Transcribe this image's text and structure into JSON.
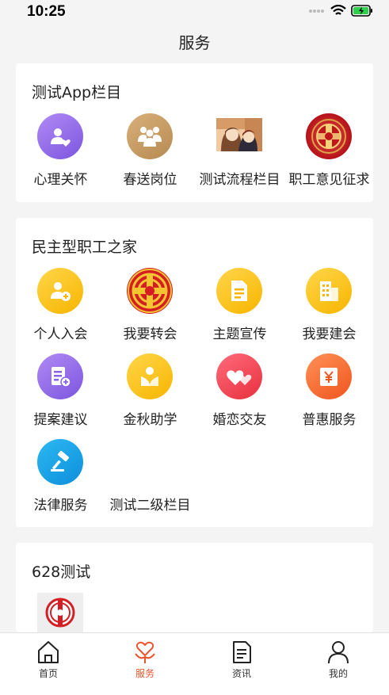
{
  "status": {
    "time": "10:25"
  },
  "header": {
    "title": "服务"
  },
  "section1": {
    "title": "测试App栏目",
    "items": [
      {
        "label": "心理关怀"
      },
      {
        "label": "春送岗位"
      },
      {
        "label": "测试流程栏目"
      },
      {
        "label": "职工意见征求"
      }
    ]
  },
  "section2": {
    "title": "民主型职工之家",
    "items": [
      {
        "label": "个人入会"
      },
      {
        "label": "我要转会"
      },
      {
        "label": "主题宣传"
      },
      {
        "label": "我要建会"
      },
      {
        "label": "提案建议"
      },
      {
        "label": "金秋助学"
      },
      {
        "label": "婚恋交友"
      },
      {
        "label": "普惠服务"
      },
      {
        "label": "法律服务"
      },
      {
        "label": "测试二级栏目"
      }
    ]
  },
  "section3": {
    "title": "628测试"
  },
  "tabbar": {
    "active": "服务",
    "accent": "#e9552f",
    "items": [
      {
        "label": "首页",
        "icon": "home-icon"
      },
      {
        "label": "服务",
        "icon": "heart-hands-icon"
      },
      {
        "label": "资讯",
        "icon": "document-icon"
      },
      {
        "label": "我的",
        "icon": "user-icon"
      }
    ]
  }
}
